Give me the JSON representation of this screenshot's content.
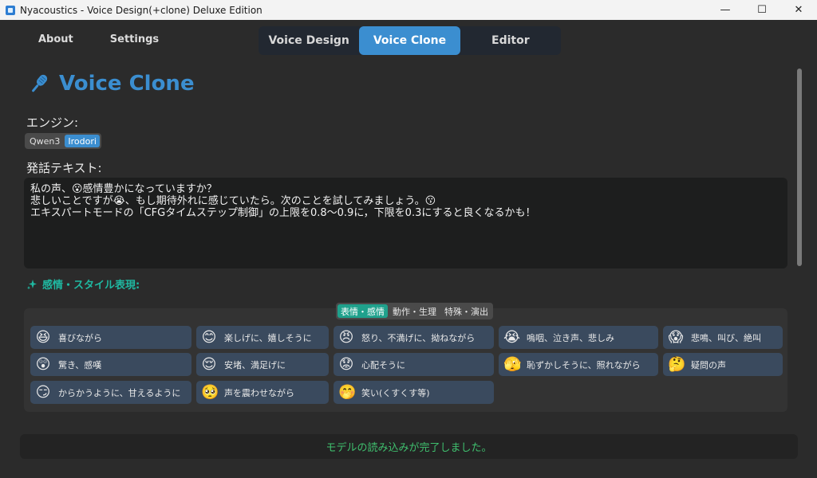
{
  "window": {
    "title": "Nyacoustics - Voice Design(+clone) Deluxe Edition",
    "minimize": "—",
    "maximize": "☐",
    "close": "✕"
  },
  "nav": {
    "about": "About",
    "settings": "Settings"
  },
  "tabs": [
    {
      "label": "Voice Design",
      "active": false
    },
    {
      "label": "Voice Clone",
      "active": true
    },
    {
      "label": "Editor",
      "active": false
    }
  ],
  "page": {
    "title": "Voice Clone",
    "icon": "microphone-icon",
    "accent": "#3b8ed0"
  },
  "engine": {
    "label": "エンジン:",
    "options": [
      "Qwen3",
      "Irodori"
    ],
    "selected": "Irodori"
  },
  "text_input": {
    "label": "発話テキスト:",
    "value": "私の声、😮感情豊かになっていますか？\n悲しいことですが😭、もし期待外れに感じていたら。次のことを試してみましょう。😗\nエキスパートモードの「CFGタイムステップ制御」の上限を0.8〜0.9に，下限を0.3にすると良くなるかも！"
  },
  "style_section": {
    "header": "感情・スタイル表現:",
    "icon": "sparkle-icon",
    "accent": "#1fb8a1",
    "categories": [
      "表情・感情",
      "動作・生理",
      "特殊・演出"
    ],
    "selected_category": "表情・感情",
    "buttons": [
      {
        "emoji": "😆",
        "label": "喜びながら"
      },
      {
        "emoji": "😊",
        "label": "楽しげに、嬉しそうに"
      },
      {
        "emoji": "😠",
        "label": "怒り、不満げに、拗ねながら"
      },
      {
        "emoji": "😭",
        "label": "嗚咽、泣き声、悲しみ"
      },
      {
        "emoji": "😱",
        "label": "悲鳴、叫び、絶叫"
      },
      {
        "emoji": "😲",
        "label": "驚き、感嘆"
      },
      {
        "emoji": "😌",
        "label": "安堵、満足げに"
      },
      {
        "emoji": "😟",
        "label": "心配そうに"
      },
      {
        "emoji": "🫣",
        "label": "恥ずかしそうに、照れながら"
      },
      {
        "emoji": "🤔",
        "label": "疑問の声"
      },
      {
        "emoji": "😏",
        "label": "からかうように、甘えるように"
      },
      {
        "emoji": "🥺",
        "label": "声を震わせながら"
      },
      {
        "emoji": "🤭",
        "label": "笑い(くすくす等)"
      }
    ]
  },
  "status": {
    "message": "モデルの読み込みが完了しました。",
    "color": "#3fbf6e"
  }
}
